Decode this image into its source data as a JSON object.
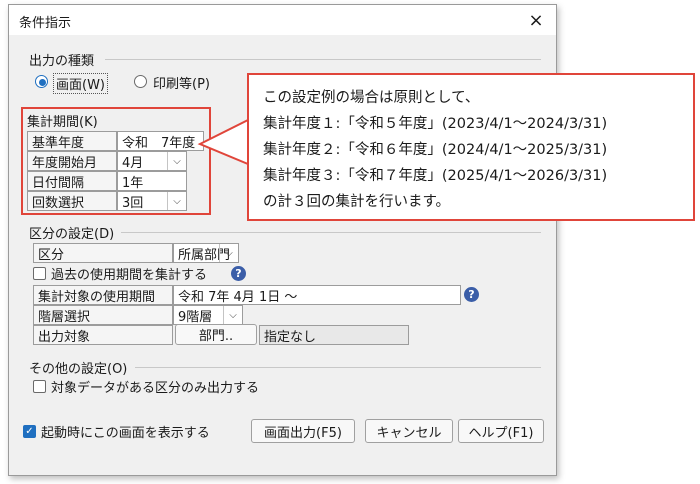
{
  "dialog": {
    "title": "条件指示",
    "close_icon": "×"
  },
  "output_type": {
    "legend": "出力の種類",
    "option_screen": "画面(W)",
    "option_print": "印刷等(P)",
    "selected": "screen"
  },
  "period": {
    "legend": "集計期間(K)",
    "rows": [
      {
        "label": "基準年度",
        "value": "令和　7年度"
      },
      {
        "label": "年度開始月",
        "value": "4月"
      },
      {
        "label": "日付間隔",
        "value": "1年"
      },
      {
        "label": "回数選択",
        "value": "3回"
      }
    ]
  },
  "division": {
    "legend": "区分の設定(D)",
    "kubun_label": "区分",
    "kubun_value": "所属部門",
    "past_checkbox_label": "過去の使用期間を集計する",
    "target_period_label": "集計対象の使用期間",
    "target_period_value": "令和 7年 4月 1日 ～",
    "level_label": "階層選択",
    "level_value": "9階層",
    "output_target_label": "出力対象",
    "dept_button": "部門..",
    "output_target_value": "指定なし"
  },
  "other": {
    "legend": "その他の設定(O)",
    "only_data_checkbox_label": "対象データがある区分のみ出力する"
  },
  "footer": {
    "startup_checkbox_label": "起動時にこの画面を表示する",
    "startup_checked": true,
    "screen_output_button": "画面出力(F5)",
    "cancel_button": "キャンセル",
    "help_button": "ヘルプ(F1)"
  },
  "callout": {
    "lines": [
      "この設定例の場合は原則として、",
      "集計年度１:「令和５年度」(2023/4/1～2024/3/31)",
      "集計年度２:「令和６年度」(2024/4/1～2025/3/31)",
      "集計年度３:「令和７年度」(2025/4/1～2026/3/31)",
      "の計３回の集計を行います。"
    ]
  },
  "colors": {
    "accent": "#1f6fc0",
    "highlight_red": "#e0453a",
    "help_icon": "#3b5ea8"
  }
}
